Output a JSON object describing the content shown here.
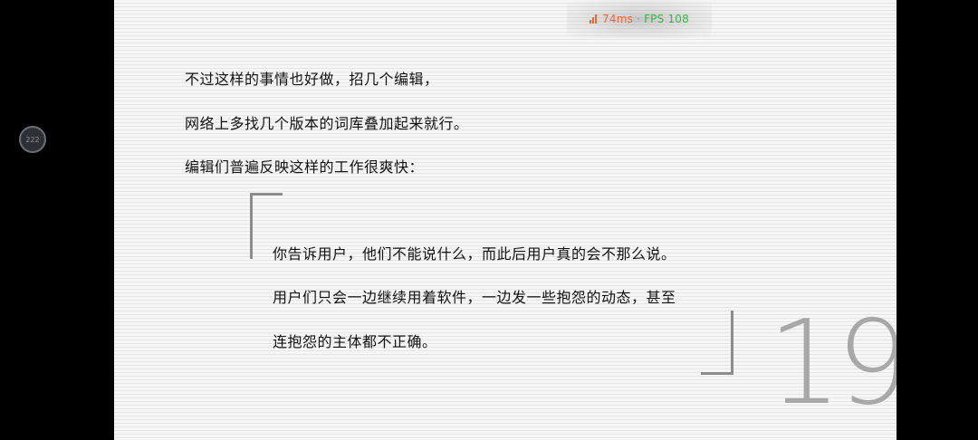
{
  "perf_overlay": {
    "icon": "signal-bars-icon",
    "latency": "74ms",
    "separator": "·",
    "fps": "FPS 108",
    "latency_color": "#e8693a",
    "fps_color": "#36b54a"
  },
  "floating_button": {
    "label": "222"
  },
  "slide": {
    "paragraphs": [
      "不过这样的事情也好做，招几个编辑，",
      "网络上多找几个版本的词库叠加起来就行。",
      "编辑们普遍反映这样的工作很爽快："
    ],
    "quote": {
      "lines": [
        "你告诉用户，他们不能说什么，而此后用户真的会不那么说。",
        "用户们只会一边继续用着软件，一边发一些抱怨的动态，甚至",
        "连抱怨的主体都不正确。"
      ]
    },
    "page_number": "19"
  }
}
